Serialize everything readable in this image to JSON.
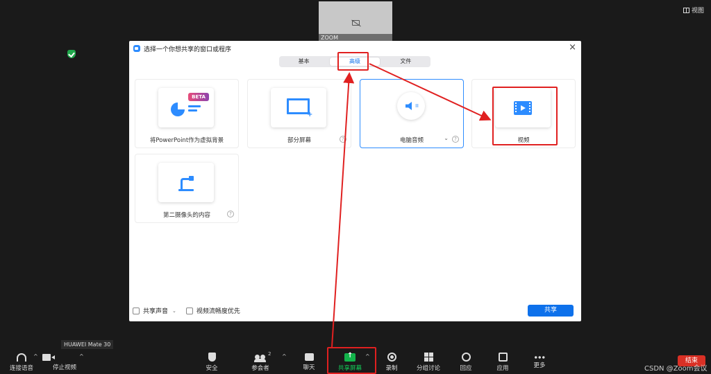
{
  "preview": {
    "tile_label": "ZOOM",
    "view_label": "视图"
  },
  "dialog": {
    "title": "选择一个你想共享的窗口或程序",
    "close": "×",
    "tabs": [
      {
        "label": "基本",
        "active": false
      },
      {
        "label": "高级",
        "active": true
      },
      {
        "label": "文件",
        "active": false
      }
    ],
    "cards": {
      "ppt": {
        "label": "将PowerPoint作为虚拟背景",
        "badge": "BETA"
      },
      "partial": {
        "label": "部分屏幕",
        "help": "?"
      },
      "audio": {
        "label": "电脑音频",
        "chevron": "⌄",
        "help": "?"
      },
      "video": {
        "label": "视频"
      },
      "camera2": {
        "label": "第二摄像头的内容",
        "help": "?"
      }
    },
    "footer": {
      "share_sound": "共享声音",
      "dropdown": "⌄",
      "optimize_video": "视频流畅度优先",
      "share_button": "共享"
    }
  },
  "device_tip": "HUAWEI Mate 30",
  "toolbar": {
    "audio": "连接语音",
    "video": "停止视频",
    "security": "安全",
    "participants": "参会者",
    "participants_count": "2",
    "chat": "聊天",
    "share": "共享屏幕",
    "record": "录制",
    "breakout": "分组讨论",
    "reactions": "回应",
    "apps": "应用",
    "more": "更多",
    "caret": "^",
    "end": "结束"
  },
  "watermark": "CSDN @Zoom会议",
  "colors": {
    "accent": "#0e71eb",
    "annotation": "#e02020",
    "share_green": "#12b34a"
  }
}
